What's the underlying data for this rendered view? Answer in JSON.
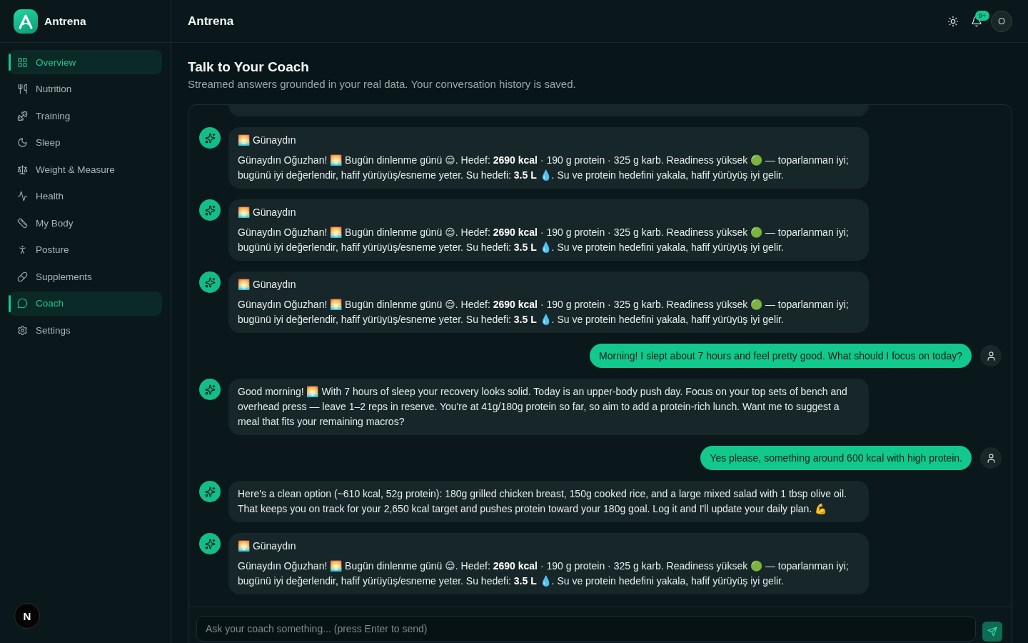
{
  "sidebar": {
    "brand": "Antrena",
    "items": [
      {
        "label": "Overview",
        "selected": true
      },
      {
        "label": "Nutrition",
        "selected": false
      },
      {
        "label": "Training",
        "selected": false
      },
      {
        "label": "Sleep",
        "selected": false
      },
      {
        "label": "Weight & Measure",
        "selected": false
      },
      {
        "label": "Health",
        "selected": false
      },
      {
        "label": "My Body",
        "selected": false
      },
      {
        "label": "Posture",
        "selected": false
      },
      {
        "label": "Supplements",
        "selected": false
      },
      {
        "label": "Coach",
        "selected": true
      },
      {
        "label": "Settings",
        "selected": false
      }
    ],
    "dev_badge": "N"
  },
  "header": {
    "title": "Antrena",
    "notification_badge": "9+",
    "avatar_initial": "O"
  },
  "page": {
    "title": "Talk to Your Coach",
    "subtitle": "Streamed answers grounded in your real data. Your conversation history is saved."
  },
  "chat": {
    "messages": [
      {
        "kind": "clipped"
      },
      {
        "kind": "assistant",
        "title": "🌅 Günaydın",
        "text": "Günaydın Oğuzhan! 🌅 Bugün dinlenme günü 😌. Hedef: **2690 kcal** · 190 g protein · 325 g karb. Readiness yüksek 🟢 — toparlanman iyi; bugünü iyi değerlendir, hafif yürüyüş/esneme yeter. Su hedefi: **3.5 L** 💧. Su ve protein hedefini yakala, hafif yürüyüş iyi gelir."
      },
      {
        "kind": "assistant",
        "title": "🌅 Günaydın",
        "text": "Günaydın Oğuzhan! 🌅 Bugün dinlenme günü 😌. Hedef: **2690 kcal** · 190 g protein · 325 g karb. Readiness yüksek 🟢 — toparlanman iyi; bugünü iyi değerlendir, hafif yürüyüş/esneme yeter. Su hedefi: **3.5 L** 💧. Su ve protein hedefini yakala, hafif yürüyüş iyi gelir."
      },
      {
        "kind": "assistant",
        "title": "🌅 Günaydın",
        "text": "Günaydın Oğuzhan! 🌅 Bugün dinlenme günü 😌. Hedef: **2690 kcal** · 190 g protein · 325 g karb. Readiness yüksek 🟢 — toparlanman iyi; bugünü iyi değerlendir, hafif yürüyüş/esneme yeter. Su hedefi: **3.5 L** 💧. Su ve protein hedefini yakala, hafif yürüyüş iyi gelir."
      },
      {
        "kind": "user",
        "text": "Morning! I slept about 7 hours and feel pretty good. What should I focus on today?"
      },
      {
        "kind": "assistant",
        "text": "Good morning! 🌅 With 7 hours of sleep your recovery looks solid. Today is an upper-body push day. Focus on your top sets of bench and overhead press — leave 1–2 reps in reserve. You're at 41g/180g protein so far, so aim to add a protein-rich lunch. Want me to suggest a meal that fits your remaining macros?"
      },
      {
        "kind": "user",
        "text": "Yes please, something around 600 kcal with high protein."
      },
      {
        "kind": "assistant",
        "text": "Here's a clean option (~610 kcal, 52g protein): 180g grilled chicken breast, 150g cooked rice, and a large mixed salad with 1 tbsp olive oil. That keeps you on track for your 2,650 kcal target and pushes protein toward your 180g goal. Log it and I'll update your daily plan. 💪"
      },
      {
        "kind": "assistant",
        "title": "🌅 Günaydın",
        "text": "Günaydın Oğuzhan! 🌅 Bugün dinlenme günü 😌. Hedef: **2690 kcal** · 190 g protein · 325 g karb. Readiness yüksek 🟢 — toparlanman iyi; bugünü iyi değerlendir, hafif yürüyüş/esneme yeter. Su hedefi: **3.5 L** 💧. Su ve protein hedefini yakala, hafif yürüyüş iyi gelir."
      }
    ],
    "input": {
      "placeholder": "Ask your coach something... (press Enter to send)"
    }
  }
}
